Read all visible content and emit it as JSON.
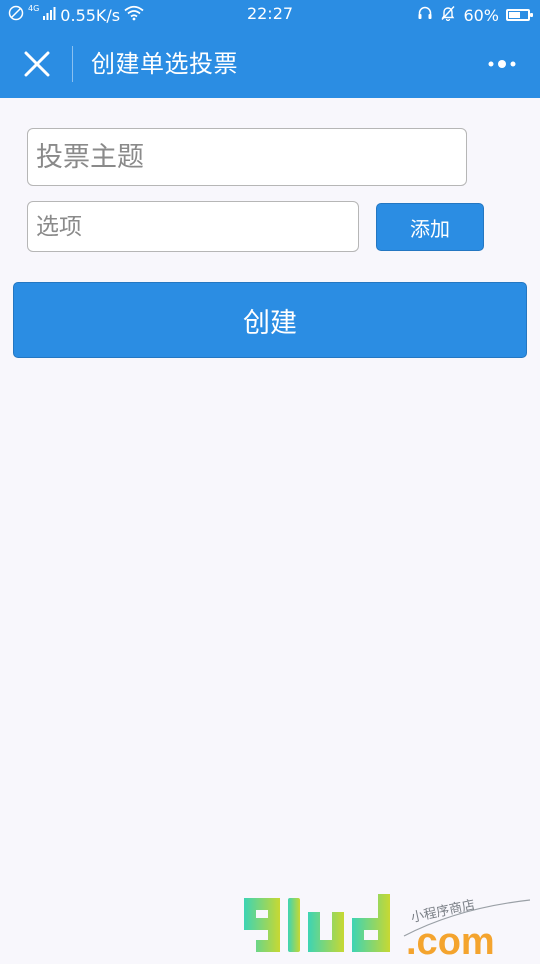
{
  "status_bar": {
    "network_type": "4G",
    "speed": "0.55K/s",
    "time": "22:27",
    "battery": "60%",
    "battery_level": 0.6
  },
  "nav": {
    "title": "创建单选投票",
    "close_icon": "close-icon",
    "more_icon": "more-icon"
  },
  "form": {
    "title_placeholder": "投票主题",
    "title_value": "",
    "option_placeholder": "选项",
    "option_value": "",
    "add_label": "添加",
    "create_label": "创建"
  },
  "watermark": {
    "logo_text": "91ud.com",
    "tagline": "小程序商店"
  },
  "colors": {
    "primary": "#2b8de3",
    "background": "#f8f7fc",
    "field_border": "#b6b6b6",
    "watermark_gradient_start": "#3dd4b4",
    "watermark_gradient_end": "#c7d832",
    "watermark_dot_com": "#f4a42e"
  }
}
